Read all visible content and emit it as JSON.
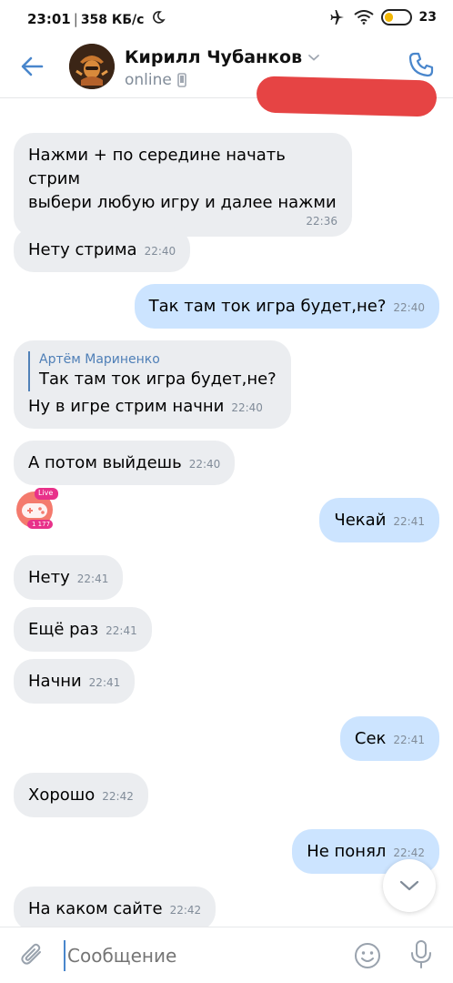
{
  "status_bar": {
    "time": "23:01",
    "speed": "358 КБ/с",
    "battery": "23"
  },
  "header": {
    "contact_name": "Кирилл Чубанков",
    "status": "online"
  },
  "messages": [
    {
      "dir": "in",
      "text_1": "Нажми + по середине начать стрим",
      "text_2": "выбери любую игру и далее нажми",
      "time": "22:36"
    },
    {
      "dir": "in",
      "text": "Нету стрима",
      "time": "22:40"
    },
    {
      "dir": "out",
      "text": "Так там ток игра будет,не?",
      "time": "22:40"
    },
    {
      "dir": "in",
      "quote_author": "Артём Мариненко",
      "quote_text": "Так там ток игра будет,не?",
      "text": "Ну в игре стрим начни",
      "time": "22:40"
    },
    {
      "dir": "in",
      "text": "А потом выйдешь",
      "time": "22:40"
    },
    {
      "dir": "out",
      "text": "Чекай",
      "time": "22:41"
    },
    {
      "dir": "in",
      "text": "Нету",
      "time": "22:41"
    },
    {
      "dir": "in",
      "text": "Ещё раз",
      "time": "22:41"
    },
    {
      "dir": "in",
      "text": "Начни",
      "time": "22:41"
    },
    {
      "dir": "out",
      "text": "Сек",
      "time": "22:41"
    },
    {
      "dir": "in",
      "text": "Хорошо",
      "time": "22:42"
    },
    {
      "dir": "out",
      "text": "Не понял",
      "time": "22:42"
    },
    {
      "dir": "in",
      "text": "На каком сайте",
      "time": "22:42"
    }
  ],
  "sticker": {
    "live_badge": "Live",
    "viewers": "1 177"
  },
  "composer": {
    "placeholder": "Сообщение"
  },
  "colors": {
    "accent": "#4986cc",
    "incoming_bubble": "#ebedf0",
    "outgoing_bubble": "#cce4ff",
    "redaction": "#e64444"
  }
}
